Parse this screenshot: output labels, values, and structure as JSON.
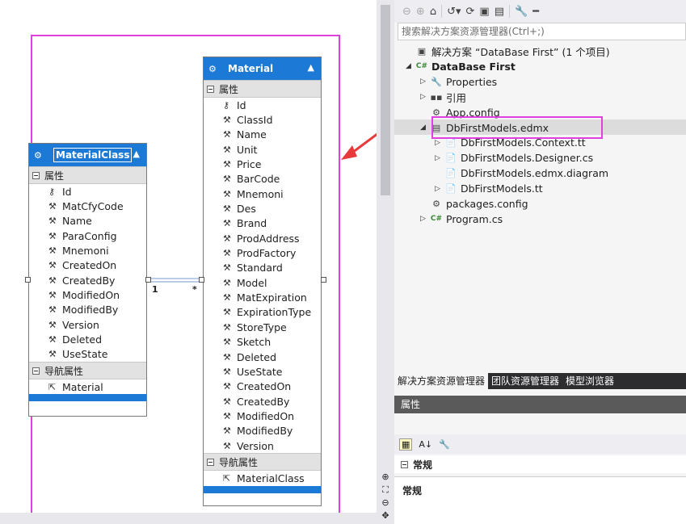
{
  "entities": {
    "materialclass": {
      "title": "MaterialClass",
      "props_header": "属性",
      "props": [
        "Id",
        "MatCfyCode",
        "Name",
        "ParaConfig",
        "Mnemoni",
        "CreatedOn",
        "CreatedBy",
        "ModifiedOn",
        "ModifiedBy",
        "Version",
        "Deleted",
        "UseState"
      ],
      "nav_header": "导航属性",
      "nav": [
        "Material"
      ]
    },
    "material": {
      "title": "Material",
      "props_header": "属性",
      "props": [
        "Id",
        "ClassId",
        "Name",
        "Unit",
        "Price",
        "BarCode",
        "Mnemoni",
        "Des",
        "Brand",
        "ProdAddress",
        "ProdFactory",
        "Standard",
        "Model",
        "MatExpiration",
        "ExpirationType",
        "StoreType",
        "Sketch",
        "Deleted",
        "UseState",
        "CreatedOn",
        "CreatedBy",
        "ModifiedOn",
        "ModifiedBy",
        "Version"
      ],
      "nav_header": "导航属性",
      "nav": [
        "MaterialClass"
      ]
    },
    "association": {
      "left": "1",
      "right": "*"
    }
  },
  "solution_explorer": {
    "search_placeholder": "搜索解决方案资源管理器(Ctrl+;)",
    "tree": [
      {
        "label": "解决方案 “DataBase First” (1 个项目)",
        "level": 0,
        "icon": "solution-icon",
        "arrow": ""
      },
      {
        "label": "DataBase First",
        "level": 0,
        "icon": "csharp-project-icon",
        "arrow": "◢",
        "bold": true
      },
      {
        "label": "Properties",
        "level": 1,
        "icon": "wrench-icon",
        "arrow": "▷"
      },
      {
        "label": "引用",
        "level": 1,
        "icon": "references-icon",
        "arrow": "▷"
      },
      {
        "label": "App.config",
        "level": 1,
        "icon": "config-file-icon",
        "arrow": ""
      },
      {
        "label": "DbFirstModels.edmx",
        "level": 1,
        "icon": "edmx-file-icon",
        "arrow": "◢",
        "selected": true
      },
      {
        "label": "DbFirstModels.Context.tt",
        "level": 2,
        "icon": "tt-file-icon",
        "arrow": "▷"
      },
      {
        "label": "DbFirstModels.Designer.cs",
        "level": 2,
        "icon": "tt-file-icon",
        "arrow": "▷"
      },
      {
        "label": "DbFirstModels.edmx.diagram",
        "level": 2,
        "icon": "tt-file-icon",
        "arrow": ""
      },
      {
        "label": "DbFirstModels.tt",
        "level": 2,
        "icon": "tt-file-icon",
        "arrow": "▷"
      },
      {
        "label": "packages.config",
        "level": 1,
        "icon": "config-file-icon",
        "arrow": ""
      },
      {
        "label": "Program.cs",
        "level": 1,
        "icon": "csharp-file-icon",
        "arrow": "▷"
      }
    ],
    "tabs": [
      "解决方案资源管理器",
      "团队资源管理器",
      "模型浏览器"
    ]
  },
  "properties_panel": {
    "title": "属性",
    "category": "常规",
    "description": "常规"
  },
  "colors": {
    "entity_header": "#1c7ad6",
    "highlight": "#e040e0",
    "arrow": "#e83a3a"
  }
}
